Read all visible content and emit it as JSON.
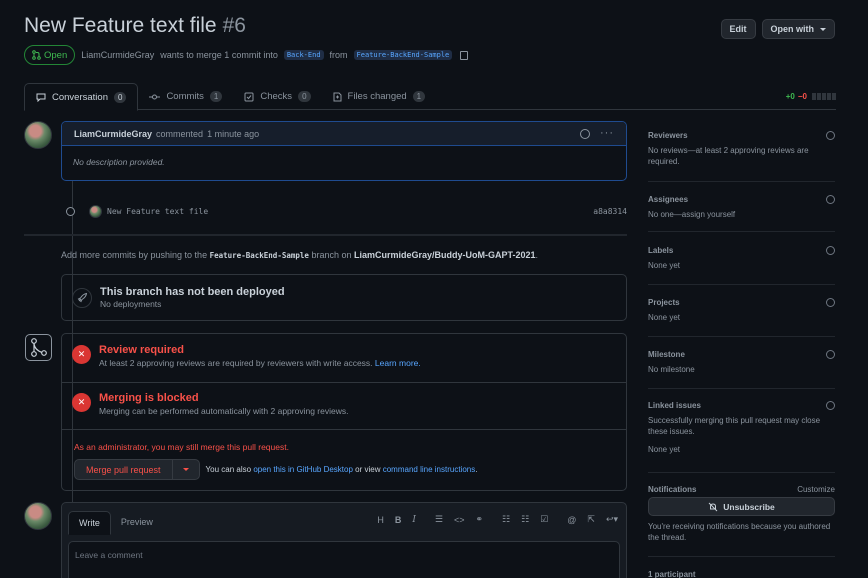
{
  "pr": {
    "title": "New Feature text file",
    "number": "#6",
    "state": "Open",
    "author": "LiamCurmideGray",
    "meta_text": "wants to merge 1 commit into",
    "base_branch": "Back-End",
    "from_text": "from",
    "head_branch": "Feature-BackEnd-Sample"
  },
  "header": {
    "edit_label": "Edit",
    "open_with_label": "Open with"
  },
  "tabs": [
    {
      "label": "Conversation",
      "count": "0"
    },
    {
      "label": "Commits",
      "count": "1"
    },
    {
      "label": "Checks",
      "count": "0"
    },
    {
      "label": "Files changed",
      "count": "1"
    }
  ],
  "diffstat": {
    "additions": "+0",
    "deletions": "−0"
  },
  "comment": {
    "author": "LiamCurmideGray",
    "action": "commented",
    "time": "1 minute ago",
    "body": "No description provided."
  },
  "commit": {
    "message": "New Feature text file",
    "sha": "a8a8314"
  },
  "push_info": {
    "prefix": "Add more commits by pushing to the",
    "branch": "Feature-BackEnd-Sample",
    "middle": "branch on",
    "repo": "LiamCurmideGray/Buddy-UoM-GAPT-2021",
    "suffix": "."
  },
  "deploy": {
    "title": "This branch has not been deployed",
    "subtitle": "No deployments"
  },
  "merge": {
    "review_title": "Review required",
    "review_sub": "At least 2 approving reviews are required by reviewers with write access.",
    "learn_more": "Learn more.",
    "blocked_title": "Merging is blocked",
    "blocked_sub": "Merging can be performed automatically with 2 approving reviews.",
    "admin_note": "As an administrator, you may still merge this pull request.",
    "merge_button": "Merge pull request",
    "also_prefix": "You can also",
    "desktop_link": "open this in GitHub Desktop",
    "or_view": "or view",
    "cli_link": "command line instructions",
    "also_suffix": "."
  },
  "compose": {
    "write_tab": "Write",
    "preview_tab": "Preview",
    "placeholder": "Leave a comment"
  },
  "sidebar": {
    "reviewers": {
      "title": "Reviewers",
      "text": "No reviews—at least 2 approving reviews are required."
    },
    "assignees": {
      "title": "Assignees",
      "text": "No one—assign yourself"
    },
    "labels": {
      "title": "Labels",
      "text": "None yet"
    },
    "projects": {
      "title": "Projects",
      "text": "None yet"
    },
    "milestone": {
      "title": "Milestone",
      "text": "No milestone"
    },
    "linked": {
      "title": "Linked issues",
      "text": "Successfully merging this pull request may close these issues.",
      "text2": "None yet"
    },
    "notifications": {
      "title": "Notifications",
      "customize": "Customize",
      "button": "Unsubscribe",
      "text": "You're receiving notifications because you authored the thread."
    },
    "participants": {
      "title": "1 participant"
    }
  },
  "colors": {
    "open_green": "#3fb950",
    "danger_red": "#f85149",
    "link_blue": "#58a6ff",
    "bg": "#0d1117"
  }
}
